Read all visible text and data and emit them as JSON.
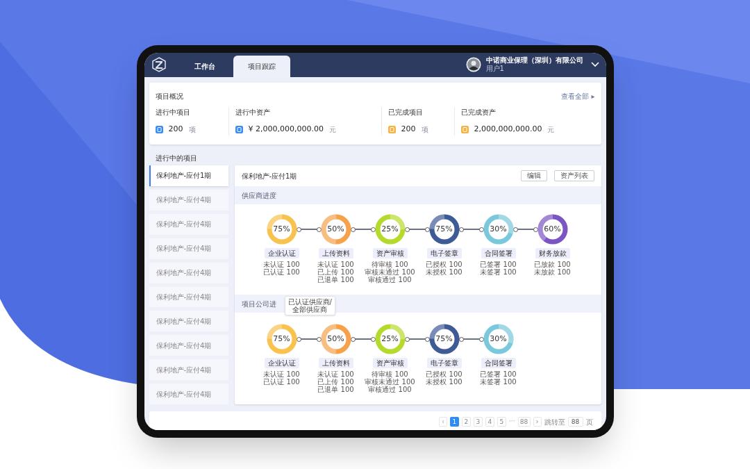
{
  "header": {
    "tabs": [
      {
        "label": "工作台",
        "selected": false
      },
      {
        "label": "项目跟踪",
        "selected": true
      }
    ],
    "company": "中诺商业保理（深圳）有限公司",
    "user": "用户1"
  },
  "overview": {
    "title": "项目概况",
    "view_all": "查看全部 ▸",
    "stats": [
      {
        "label": "进行中项目",
        "value": "200",
        "unit": "项",
        "color": "#3b8cf5"
      },
      {
        "label": "进行中资产",
        "value": "¥ 2,000,000,000.00",
        "unit": "元",
        "color": "#3b8cf5"
      },
      {
        "label": "已完成项目",
        "value": "200",
        "unit": "项",
        "color": "#f7b244"
      },
      {
        "label": "已完成资产",
        "value": "2,000,000,000.00",
        "unit": "元",
        "color": "#f7b244"
      }
    ]
  },
  "projects": {
    "title": "进行中的项目",
    "items": [
      {
        "label": "保利地产-应付1期",
        "selected": true
      },
      {
        "label": "保利地产-应付4期",
        "selected": false
      },
      {
        "label": "保利地产-应付4期",
        "selected": false
      },
      {
        "label": "保利地产-应付4期",
        "selected": false
      },
      {
        "label": "保利地产-应付4期",
        "selected": false
      },
      {
        "label": "保利地产-应付4期",
        "selected": false
      },
      {
        "label": "保利地产-应付4期",
        "selected": false
      },
      {
        "label": "保利地产-应付4期",
        "selected": false
      },
      {
        "label": "保利地产-应付4期",
        "selected": false
      },
      {
        "label": "保利地产-应付4期",
        "selected": false
      }
    ]
  },
  "detail": {
    "title": "保利地产-应付1期",
    "buttons": [
      "编辑",
      "资产列表"
    ],
    "sections": [
      {
        "title": "供应商进度",
        "stages": [
          {
            "name": "企业认证",
            "percent": "75%",
            "color": "#f9c24e",
            "lines": [
              "未认证 100",
              "已认证 100"
            ]
          },
          {
            "name": "上传资料",
            "percent": "50%",
            "color": "#f5a24b",
            "lines": [
              "未认证 100",
              "已上传 100",
              "已退单 100"
            ]
          },
          {
            "name": "资产审核",
            "percent": "25%",
            "color": "#b6da2c",
            "lines": [
              "待审核 100",
              "审核未通过 100",
              "审核通过 100"
            ]
          },
          {
            "name": "电子签章",
            "percent": "75%",
            "color": "#3e5b98",
            "lines": [
              "已授权 100",
              "未授权 100"
            ]
          },
          {
            "name": "合同签署",
            "percent": "30%",
            "color": "#79c8dc",
            "lines": [
              "已签署 100",
              "未签署 100"
            ]
          },
          {
            "name": "财务放款",
            "percent": "60%",
            "color": "#7b55c4",
            "lines": [
              "已放款 100",
              "未放款 100"
            ]
          }
        ]
      },
      {
        "title": "项目公司进",
        "tooltip": [
          "已认证供应商/",
          "全部供应商"
        ],
        "stages": [
          {
            "name": "企业认证",
            "percent": "75%",
            "color": "#f9c24e",
            "lines": [
              "未认证 100",
              "已认证 100"
            ]
          },
          {
            "name": "上传资料",
            "percent": "50%",
            "color": "#f5a24b",
            "lines": [
              "未认证 100",
              "已上传 100",
              "已退单 100"
            ]
          },
          {
            "name": "资产审核",
            "percent": "25%",
            "color": "#b6da2c",
            "lines": [
              "待审核 100",
              "审核未通过 100",
              "审核通过 100"
            ]
          },
          {
            "name": "电子签章",
            "percent": "75%",
            "color": "#3e5b98",
            "lines": [
              "已授权 100",
              "未授权 100"
            ]
          },
          {
            "name": "合同签署",
            "percent": "30%",
            "color": "#79c8dc",
            "lines": [
              "已签署 100",
              "未签署 100"
            ]
          }
        ]
      }
    ]
  },
  "pagination": {
    "prev": "‹",
    "pages": [
      {
        "label": "1",
        "selected": true
      },
      {
        "label": "2",
        "selected": false
      },
      {
        "label": "3",
        "selected": false
      },
      {
        "label": "4",
        "selected": false
      },
      {
        "label": "5",
        "selected": false
      }
    ],
    "ellipsis": "···",
    "last": "88",
    "next": "›",
    "jump_label": "跳转至",
    "jump_value": "88",
    "suffix": "页"
  }
}
